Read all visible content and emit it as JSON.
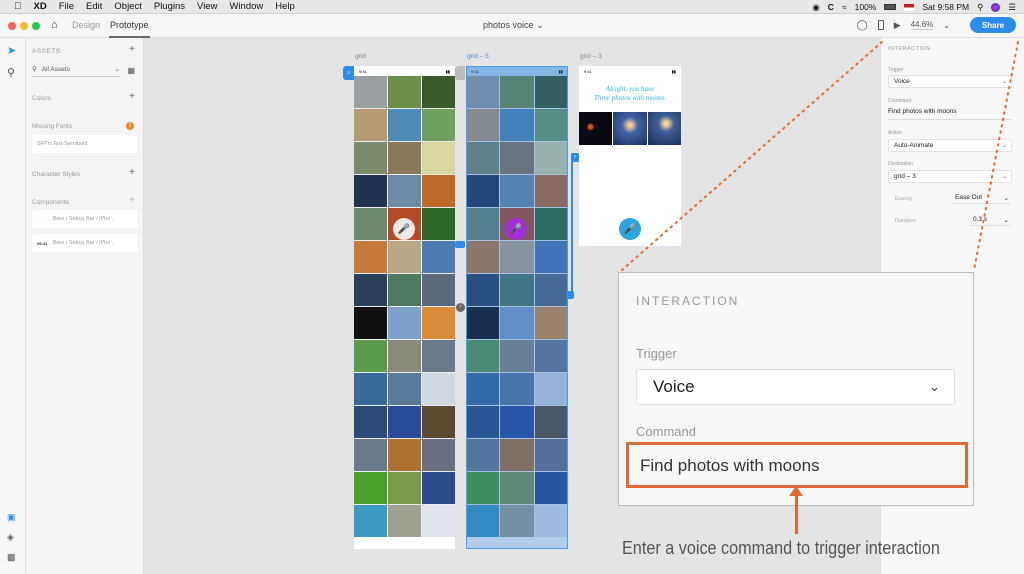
{
  "menubar": {
    "app": "XD",
    "items": [
      "File",
      "Edit",
      "Object",
      "Plugins",
      "View",
      "Window",
      "Help"
    ],
    "battery": "100%",
    "clock": "Sat 9:58 PM"
  },
  "titlebar": {
    "tabs": [
      {
        "label": "Design",
        "active": false
      },
      {
        "label": "Prototype",
        "active": true
      }
    ],
    "doc_title": "photos voice",
    "zoom": "44.6%",
    "share_label": "Share"
  },
  "left_panel": {
    "header": "ASSETS",
    "filter": "All Assets",
    "sections": {
      "colors": "Colors",
      "missing_fonts": "Missing Fonts",
      "missing_font_item": "SFProText-Semibold",
      "character_styles": "Character Styles",
      "components": "Components"
    },
    "components": [
      {
        "thumb": "- -",
        "label": "Bars / Status Bar / iPho..."
      },
      {
        "thumb": "09:41",
        "label": "Bars / Status Bar / iPho..."
      }
    ]
  },
  "canvas": {
    "artboards": [
      {
        "name": "grid",
        "selected": false
      },
      {
        "name": "grid – 5",
        "selected": true
      },
      {
        "name": "grid – 3",
        "selected": false
      }
    ],
    "status_time": "9:41",
    "response_text_line1": "Alright, you have",
    "response_text_line2": "Three photos with moons."
  },
  "right_panel": {
    "header": "INTERACTION",
    "trigger_label": "Trigger",
    "trigger_value": "Voice",
    "command_label": "Command",
    "command_value": "Find photos with moons",
    "action_label": "Action",
    "action_value": "Auto-Animate",
    "destination_label": "Destination",
    "destination_value": "grid – 3",
    "easing_label": "Easing",
    "easing_value": "Ease Out",
    "duration_label": "Duration",
    "duration_value": "0.3 s"
  },
  "callout": {
    "header": "INTERACTION",
    "trigger_label": "Trigger",
    "trigger_value": "Voice",
    "command_label": "Command",
    "command_value": "Find photos with moons",
    "caption": "Enter a voice command to trigger interaction",
    "accent": "#e06a35"
  }
}
